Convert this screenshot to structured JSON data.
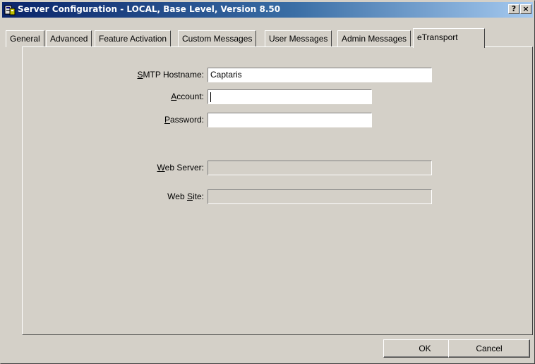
{
  "window": {
    "title": "Server Configuration - LOCAL, Base Level, Version 8.50",
    "help_button": "?",
    "close_button": "×"
  },
  "tabs": [
    {
      "label": "General",
      "active": false
    },
    {
      "label": "Advanced",
      "active": false
    },
    {
      "label": "Feature Activation",
      "active": false
    },
    {
      "label": "Custom Messages",
      "active": false
    },
    {
      "label": "User Messages",
      "active": false
    },
    {
      "label": "Admin Messages",
      "active": false
    },
    {
      "label": "eTransport",
      "active": true
    }
  ],
  "form": {
    "smtp_hostname": {
      "label_hotkey": "S",
      "label_rest": "MTP Hostname:",
      "value": "Captaris"
    },
    "account": {
      "label_hotkey": "A",
      "label_rest": "ccount:",
      "value": ""
    },
    "password": {
      "label_hotkey": "P",
      "label_rest": "assword:",
      "value": ""
    },
    "web_server": {
      "label_hotkey": "W",
      "label_rest": "eb Server:",
      "value": ""
    },
    "web_site": {
      "label_pre": "Web ",
      "label_hotkey": "S",
      "label_rest": "ite:",
      "value": ""
    }
  },
  "buttons": {
    "ok": "OK",
    "cancel": "Cancel"
  },
  "icons": {
    "title_icon": "server-config-icon"
  }
}
